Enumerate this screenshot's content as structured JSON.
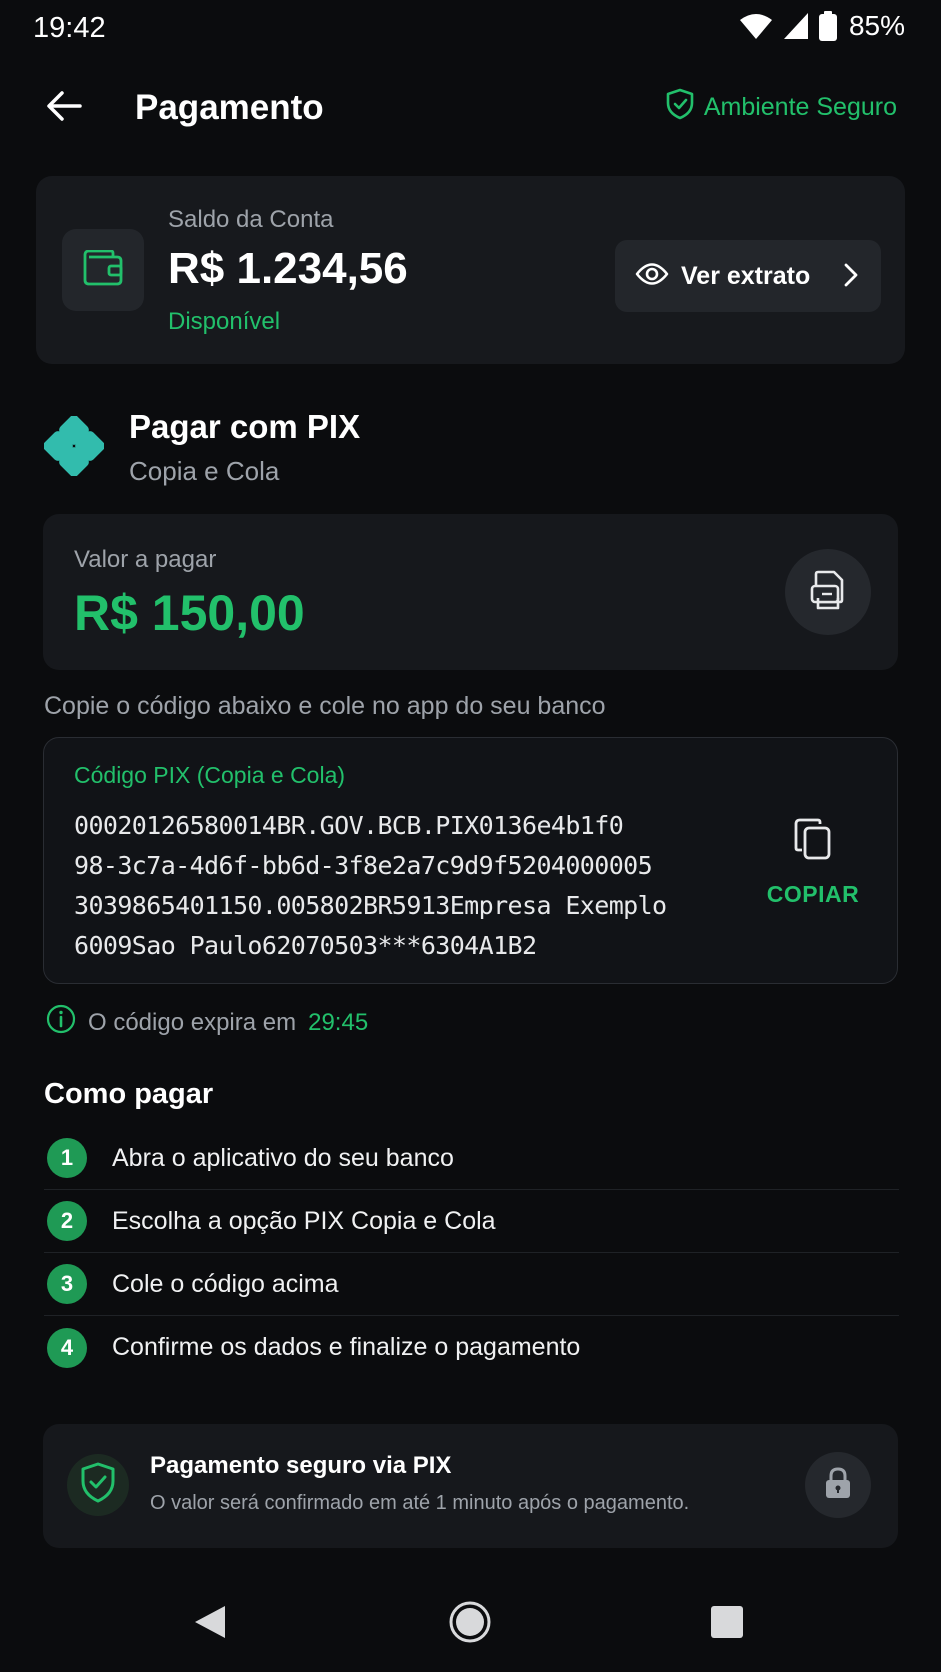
{
  "status_bar": {
    "time": "19:42",
    "battery": "85%"
  },
  "header": {
    "title": "Pagamento",
    "secure_label": "Ambiente Seguro"
  },
  "balance": {
    "label": "Saldo da Conta",
    "value": "R$ 1.234,56",
    "status": "Disponível",
    "statement_button": "Ver extrato"
  },
  "pix": {
    "title": "Pagar com PIX",
    "subtitle": "Copia e Cola"
  },
  "amount": {
    "label": "Valor a pagar",
    "value": "R$ 150,00"
  },
  "instruction": "Copie o código abaixo e cole no app do seu banco",
  "code": {
    "label": "Código PIX (Copia e Cola)",
    "lines": [
      "00020126580014BR.GOV.BCB.PIX0136e4b1f0",
      "98-3c7a-4d6f-bb6d-3f8e2a7c9d9f5204000005",
      "3039865401150.005802BR5913Empresa Exemplo",
      "6009Sao Paulo62070503***6304A1B2"
    ],
    "copy_button": "COPIAR"
  },
  "expiry": {
    "text": "O código expira em",
    "time": "29:45"
  },
  "steps": {
    "title": "Como pagar",
    "items": [
      {
        "number": "1",
        "text": "Abra o aplicativo do seu banco"
      },
      {
        "number": "2",
        "text": "Escolha a opção PIX Copia e Cola"
      },
      {
        "number": "3",
        "text": "Cole o código acima"
      },
      {
        "number": "4",
        "text": "Confirme os dados e finalize o pagamento"
      }
    ]
  },
  "secure_card": {
    "title": "Pagamento seguro via PIX",
    "text": "O valor será confirmado em até 1 minuto após o pagamento."
  },
  "colors": {
    "background": "#0b0c0e",
    "card": "#17191d",
    "accent_green": "#22c06b",
    "step_badge": "#1f9a55",
    "muted_text": "#9ea3aa"
  },
  "icons": [
    "wifi-icon",
    "signal-icon",
    "battery-icon",
    "back-arrow-icon",
    "shield-check-icon",
    "wallet-icon",
    "eye-icon",
    "chevron-right-icon",
    "pix-logo-icon",
    "receipt-icon",
    "copy-icon",
    "info-icon",
    "lock-icon",
    "nav-back-icon",
    "nav-home-icon",
    "nav-recents-icon"
  ]
}
